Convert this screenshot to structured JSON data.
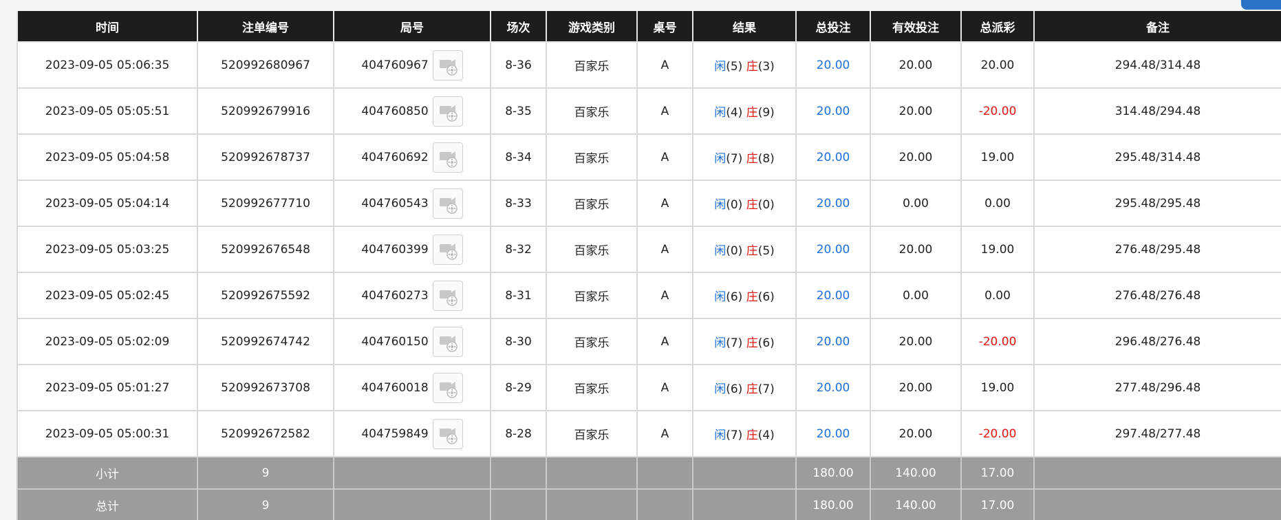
{
  "headers": [
    "时间",
    "注单编号",
    "局号",
    "场次",
    "游戏类别",
    "桌号",
    "结果",
    "总投注",
    "有效投注",
    "总派彩",
    "备注"
  ],
  "result_labels": {
    "player": "闲",
    "banker": "庄"
  },
  "colors": {
    "header_bg": "#1d1d1d",
    "total_bg": "#9c9c9c",
    "blue": "#1a6fdf",
    "red": "#e2130f"
  },
  "rows": [
    {
      "time": "2023-09-05 05:06:35",
      "bet_id": "520992680967",
      "round": "404760967",
      "session": "8-36",
      "game": "百家乐",
      "table": "A",
      "player_points": "(5)",
      "banker_points": "(3)",
      "total_bet": "20.00",
      "valid_bet": "20.00",
      "payout": "20.00",
      "payout_negative": false,
      "note": "294.48/314.48"
    },
    {
      "time": "2023-09-05 05:05:51",
      "bet_id": "520992679916",
      "round": "404760850",
      "session": "8-35",
      "game": "百家乐",
      "table": "A",
      "player_points": "(4)",
      "banker_points": "(9)",
      "total_bet": "20.00",
      "valid_bet": "20.00",
      "payout": "-20.00",
      "payout_negative": true,
      "note": "314.48/294.48"
    },
    {
      "time": "2023-09-05 05:04:58",
      "bet_id": "520992678737",
      "round": "404760692",
      "session": "8-34",
      "game": "百家乐",
      "table": "A",
      "player_points": "(7)",
      "banker_points": "(8)",
      "total_bet": "20.00",
      "valid_bet": "20.00",
      "payout": "19.00",
      "payout_negative": false,
      "note": "295.48/314.48"
    },
    {
      "time": "2023-09-05 05:04:14",
      "bet_id": "520992677710",
      "round": "404760543",
      "session": "8-33",
      "game": "百家乐",
      "table": "A",
      "player_points": "(0)",
      "banker_points": "(0)",
      "total_bet": "20.00",
      "valid_bet": "0.00",
      "payout": "0.00",
      "payout_negative": false,
      "note": "295.48/295.48"
    },
    {
      "time": "2023-09-05 05:03:25",
      "bet_id": "520992676548",
      "round": "404760399",
      "session": "8-32",
      "game": "百家乐",
      "table": "A",
      "player_points": "(0)",
      "banker_points": "(5)",
      "total_bet": "20.00",
      "valid_bet": "20.00",
      "payout": "19.00",
      "payout_negative": false,
      "note": "276.48/295.48"
    },
    {
      "time": "2023-09-05 05:02:45",
      "bet_id": "520992675592",
      "round": "404760273",
      "session": "8-31",
      "game": "百家乐",
      "table": "A",
      "player_points": "(6)",
      "banker_points": "(6)",
      "total_bet": "20.00",
      "valid_bet": "0.00",
      "payout": "0.00",
      "payout_negative": false,
      "note": "276.48/276.48"
    },
    {
      "time": "2023-09-05 05:02:09",
      "bet_id": "520992674742",
      "round": "404760150",
      "session": "8-30",
      "game": "百家乐",
      "table": "A",
      "player_points": "(7)",
      "banker_points": "(6)",
      "total_bet": "20.00",
      "valid_bet": "20.00",
      "payout": "-20.00",
      "payout_negative": true,
      "note": "296.48/276.48"
    },
    {
      "time": "2023-09-05 05:01:27",
      "bet_id": "520992673708",
      "round": "404760018",
      "session": "8-29",
      "game": "百家乐",
      "table": "A",
      "player_points": "(6)",
      "banker_points": "(7)",
      "total_bet": "20.00",
      "valid_bet": "20.00",
      "payout": "19.00",
      "payout_negative": false,
      "note": "277.48/296.48"
    },
    {
      "time": "2023-09-05 05:00:31",
      "bet_id": "520992672582",
      "round": "404759849",
      "session": "8-28",
      "game": "百家乐",
      "table": "A",
      "player_points": "(7)",
      "banker_points": "(4)",
      "total_bet": "20.00",
      "valid_bet": "20.00",
      "payout": "-20.00",
      "payout_negative": true,
      "note": "297.48/277.48"
    }
  ],
  "totals": [
    {
      "label": "小计",
      "count": "9",
      "total_bet": "180.00",
      "valid_bet": "140.00",
      "payout": "17.00"
    },
    {
      "label": "总计",
      "count": "9",
      "total_bet": "180.00",
      "valid_bet": "140.00",
      "payout": "17.00"
    }
  ]
}
